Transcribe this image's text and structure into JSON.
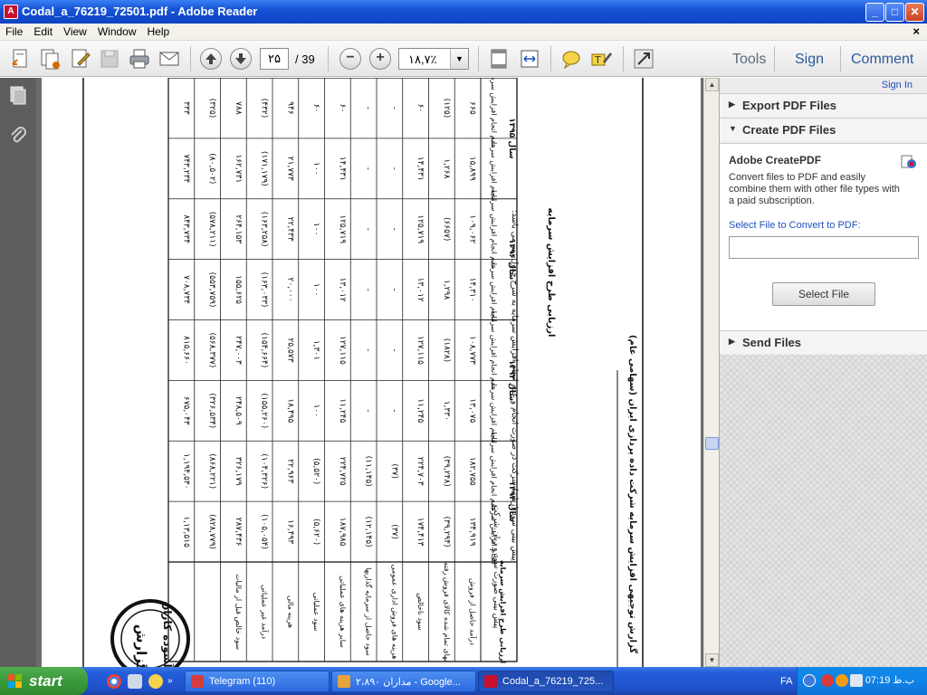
{
  "window": {
    "title": "Codal_a_76219_72501.pdf - Adobe Reader",
    "app_icon_glyph": "A",
    "minimize": "_",
    "maximize": "□",
    "close": "✕"
  },
  "menu": {
    "items": [
      "File",
      "Edit",
      "View",
      "Window",
      "Help"
    ],
    "close_doc": "×"
  },
  "toolbar": {
    "page_current": "۲۵",
    "page_total": "/ 39",
    "zoom_value": "۱۸,۷٪",
    "zoom_dropdown": "▼",
    "zoom_out": "−",
    "zoom_in": "+",
    "links": {
      "tools": "Tools",
      "sign": "Sign",
      "comment": "Comment"
    }
  },
  "document": {
    "header_text": "گزارش توجیهی افزایش سرمایه شرکت داده پردازی ایران (سهامی عام)",
    "subheader_text": "ارزیابی طرح افزایش سرمایه",
    "intro_text": "پیش بینی سود (زیان) شرکت در صورت انجام و عدم انجام افزایش سرمایه به شرح جدول زیر می باشد:",
    "intro_text2": "پیش بینی صورت سود و زیان شرکت",
    "table_header_label": "ارزیابی طرح افزایش سرمایه",
    "years": [
      "سال ۱۳۹۵",
      "سال ۱۳۹۶",
      "سال ۱۳۹۳",
      "سال ۱۳۹۴"
    ],
    "col_labels": [
      "عدم انجام افزایش سرمایه",
      "انجام افزایش سرمایه"
    ],
    "row_labels": [
      "درآمد حاصل از فروش",
      "بهای تمام شده کالای فروش رفته",
      "سود ناخالص",
      "هزینه های فروش اداری عمومی",
      "سود حاصل از سرمایه گذاریها",
      "سایر هزینه های عملیاتی",
      "سود عملیاتی",
      "هزینه مالی",
      "درآمد غیر عملیاتی",
      "سود خالص قبل از مالیات"
    ],
    "cells": [
      [
        "۳۳۳",
        "۷۴۳,۲۳۴",
        "۸۴۳,۷۳۴",
        "۷۰۸,۷۳۴",
        "۸۱۵,۶۶۰",
        "۶۷۵,۰۴۳",
        "۱,۱۹۴,۵۳۰",
        "۱,۱۳,۵۱۵"
      ],
      [
        "(۳۲۵)",
        "(۸۰,۵۰۲)",
        "(۵۷۸,۲۱۱)",
        "(۵۵۳,۷۵۹)",
        "(۵۶۸,۳۷۷)",
        "(۳۲۶,۵۳۴)",
        "(۸۶۸,۲۲۱)",
        "(۸۲۸,۷۷۹)"
      ],
      [
        "۷۸۸",
        "۱۶۲,۷۳۱",
        "۲۶۴,۱۵۳",
        "۱۵۵,۶۲۵",
        "۲۴۷,۰۰۳",
        "۲۴۸,۵۰۹",
        "۳۲۶,۱۷۹",
        "۲۸۷,۴۳۶"
      ],
      [
        "(۴۳۲)",
        "(۱۷۱,۱۷۹)",
        "(۱۶۳,۲۵۸)",
        "(۱۶۳,۰۳۳)",
        "(۱۵۴,۶۶۴)",
        "(۱۵۵,۲۶۰)",
        "(۱۰۴,۳۲۶)",
        "(۱۰۵,۰۵۴)"
      ],
      [
        "۹۴۶",
        "۲۱,۷۷۳",
        "۲۲,۴۳۳",
        "۲۰,۰۰۰",
        "۲۵,۵۷۳",
        "۱۸,۴۹۵",
        "۲۲,۹۶۳",
        "۱۶,۴۹۳"
      ],
      [
        "۶۰",
        "۱۰۰",
        "۱۰۰",
        "۱۰۰",
        "۱,۳۰۱",
        "۱۰۰",
        "(۵,۵۲۰)",
        "(۵,۶۲۰)"
      ],
      [
        "۶۰",
        "۱۴,۴۳۱",
        "۱۲۵,۷۱۹",
        "۱۳,۰۱۲",
        "۱۲۷,۱۱۵",
        "۱۱,۲۴۵",
        "۲۲۴,۷۲۵",
        "۱۸۷,۹۸۵"
      ],
      [
        "-",
        "-",
        "-",
        "-",
        "-",
        "-",
        "(۱۱,۱۴۵)",
        "(۱۲,۱۴۵)"
      ],
      [
        "-",
        "-",
        "-",
        "-",
        "-",
        "-",
        "(۳۷)",
        "(۳۷)"
      ],
      [
        "۶۰",
        "۱۴,۴۳۱",
        "۱۲۵,۷۱۹",
        "۱۳,۰۱۲",
        "۱۲۷,۱۱۵",
        "۱۱,۲۴۵",
        "۲۲۴,۷۰۳",
        "۱۷۴,۴۱۳"
      ],
      [
        "(۱۲۵)",
        "۱,۲۶۸",
        "(۶۶۵۷)",
        "۱,۲۹۸",
        "(۱۸۲۸)",
        "۱,۳۳۰",
        "(۳۹,۲۴۸)",
        "(۳۹,۲۹۴)"
      ],
      [
        "۶۶۵",
        "۱۵,۸۹۹",
        "۱۰۹,۰۶۲",
        "۱۴,۳۱۰",
        "۱۰۸,۷۷۳",
        "۱۳,۰۷۵",
        "۱۸۲,۷۵۵",
        "۱۳۴,۹۱۹"
      ]
    ],
    "stamp_line1": "آسوده کاران",
    "stamp_line2": "گزارش"
  },
  "right_pane": {
    "sign_in": "Sign In",
    "export_label": "Export PDF Files",
    "create_label": "Create PDF Files",
    "create_title": "Adobe CreatePDF",
    "create_desc": "Convert files to PDF and easily combine them with other file types with a paid subscription.",
    "select_label": "Select File to Convert to PDF:",
    "select_btn": "Select File",
    "send_label": "Send Files"
  },
  "taskbar": {
    "start": "start",
    "tasks": [
      {
        "label": "Telegram (110)",
        "color": "#d83b3b"
      },
      {
        "label": "مداران ۲،۸۹۰ - Google...",
        "color": "#e8a33a"
      },
      {
        "label": "Codal_a_76219_725...",
        "color": "#c8102e"
      }
    ],
    "lang": "FA",
    "clock": "07:19 ب.ظ"
  },
  "colors": {
    "titlebar": "#1653d6",
    "taskbar": "#245edb",
    "accent_link": "#1f4fbf",
    "nav_pane": "#5d5d5d",
    "doc_background": "#6c6c6c"
  }
}
